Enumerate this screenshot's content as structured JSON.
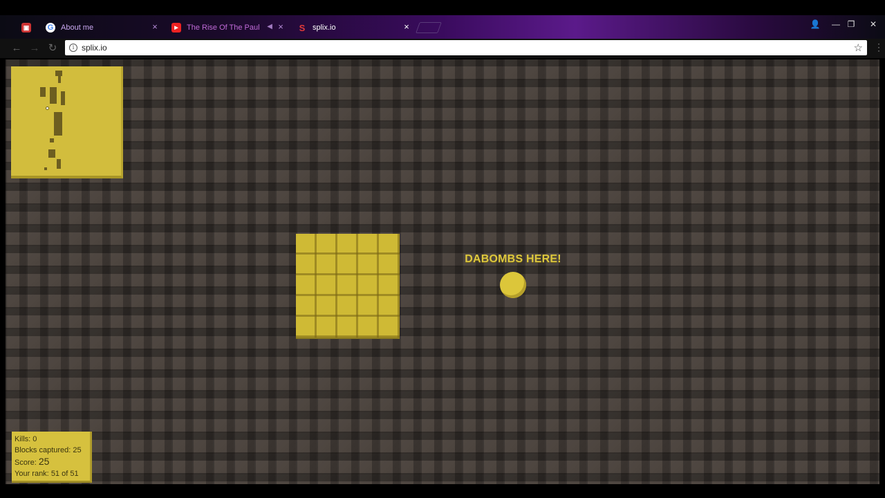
{
  "browser": {
    "tabs": [
      {
        "title": "",
        "icon": "extension-icon"
      },
      {
        "title": "About me",
        "icon": "google-icon"
      },
      {
        "title": "The Rise Of The Paul",
        "icon": "youtube-icon",
        "muted": true
      },
      {
        "title": "splix.io",
        "icon": "splix-icon",
        "active": true
      }
    ],
    "url": "splix.io",
    "window_controls": [
      "profile-icon",
      "minimize-icon",
      "restore-icon",
      "close-icon"
    ]
  },
  "game": {
    "player_name": "DABOMBS HERE!",
    "player_color": "#dcc63a",
    "background_color": "#4a423c",
    "stats": {
      "kills_label": "Kills:",
      "kills_value": "0",
      "blocks_label": "Blocks captured:",
      "blocks_value": "25",
      "score_label": "Score:",
      "score_value": "25",
      "rank_label": "Your rank:",
      "rank_value": "51 of 51"
    }
  }
}
